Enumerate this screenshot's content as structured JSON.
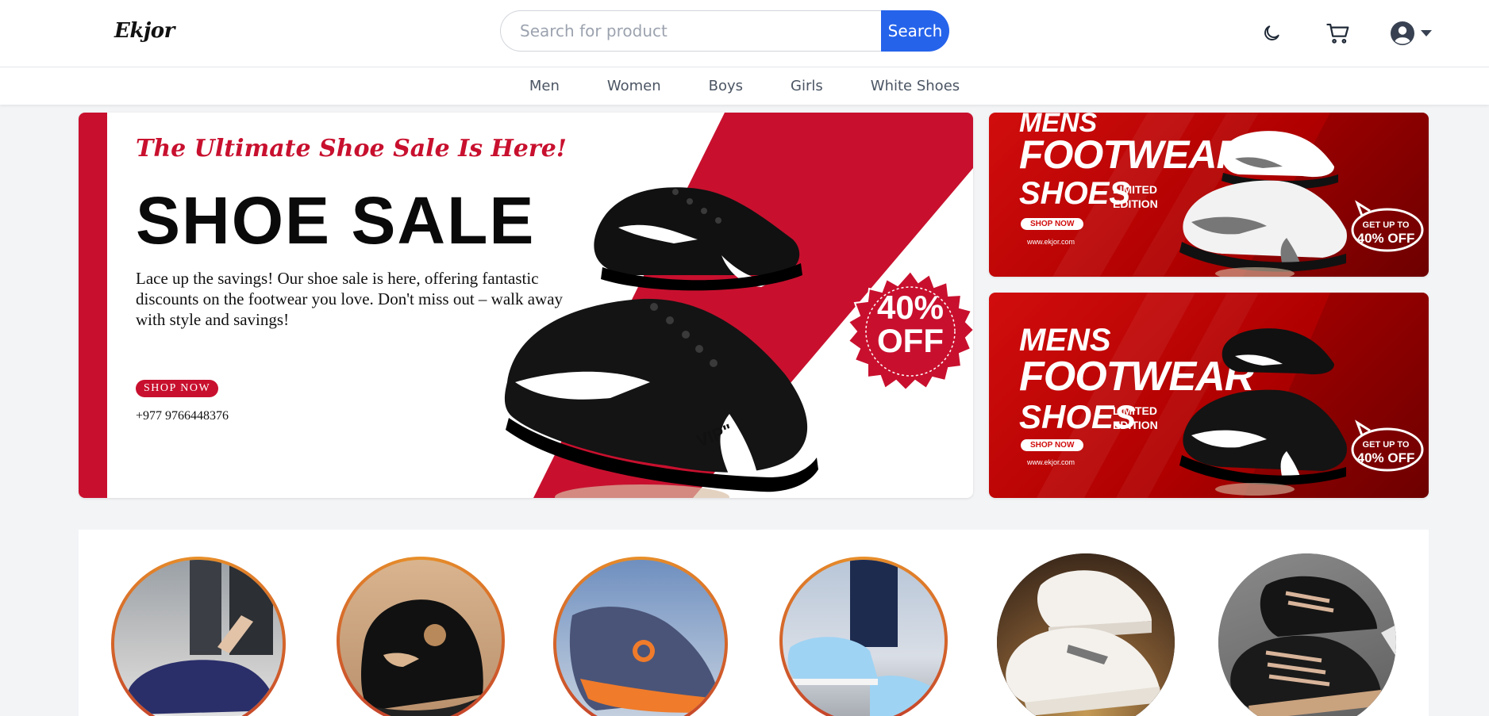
{
  "header": {
    "logo": "Ekjor",
    "search_placeholder": "Search for product",
    "search_button": "Search",
    "icons": [
      "moon-icon",
      "cart-icon",
      "user-icon",
      "caret-down-icon"
    ]
  },
  "nav": {
    "items": [
      {
        "label": "Men"
      },
      {
        "label": "Women"
      },
      {
        "label": "Boys"
      },
      {
        "label": "Girls"
      },
      {
        "label": "White Shoes"
      }
    ]
  },
  "hero": {
    "tagline": "The Ultimate Shoe Sale Is Here!",
    "headline": "SHOE SALE",
    "description": "Lace up the savings! Our shoe sale is here, offering fantastic discounts on the footwear you love. Don't miss out – walk away with style and savings!",
    "shop_button": "SHOP NOW",
    "phone": "+977 9766448376",
    "badge_top": "40%",
    "badge_bottom": "OFF",
    "shoe_label": "VIP\""
  },
  "side_banners": [
    {
      "line1": "MENS",
      "line2": "FOOTWEAR",
      "line3": "SHOES",
      "limited1": "LIMITED",
      "limited2": "EDITION",
      "shop_button": "SHOP NOW",
      "site": "www.ekjor.com",
      "getup": "GET UP TO",
      "discount": "40% OFF"
    },
    {
      "line1": "MENS",
      "line2": "FOOTWEAR",
      "line3": "SHOES",
      "limited1": "LIMITED",
      "limited2": "EDITION",
      "shop_button": "SHOP NOW",
      "site": "www.ekjor.com",
      "getup": "GET UP TO",
      "discount": "40% OFF"
    }
  ],
  "categories": [
    {
      "name": "category-navy-sneakers"
    },
    {
      "name": "category-black-sneakers"
    },
    {
      "name": "category-grey-orange-sneakers"
    },
    {
      "name": "category-light-blue-sneakers"
    },
    {
      "name": "category-white-sneakers"
    },
    {
      "name": "category-black-tan-sneakers"
    }
  ],
  "colors": {
    "accent_blue": "#2563eb",
    "brand_red": "#c8102e",
    "ring_orange": "#e8902a",
    "ring_red": "#c0392b"
  }
}
